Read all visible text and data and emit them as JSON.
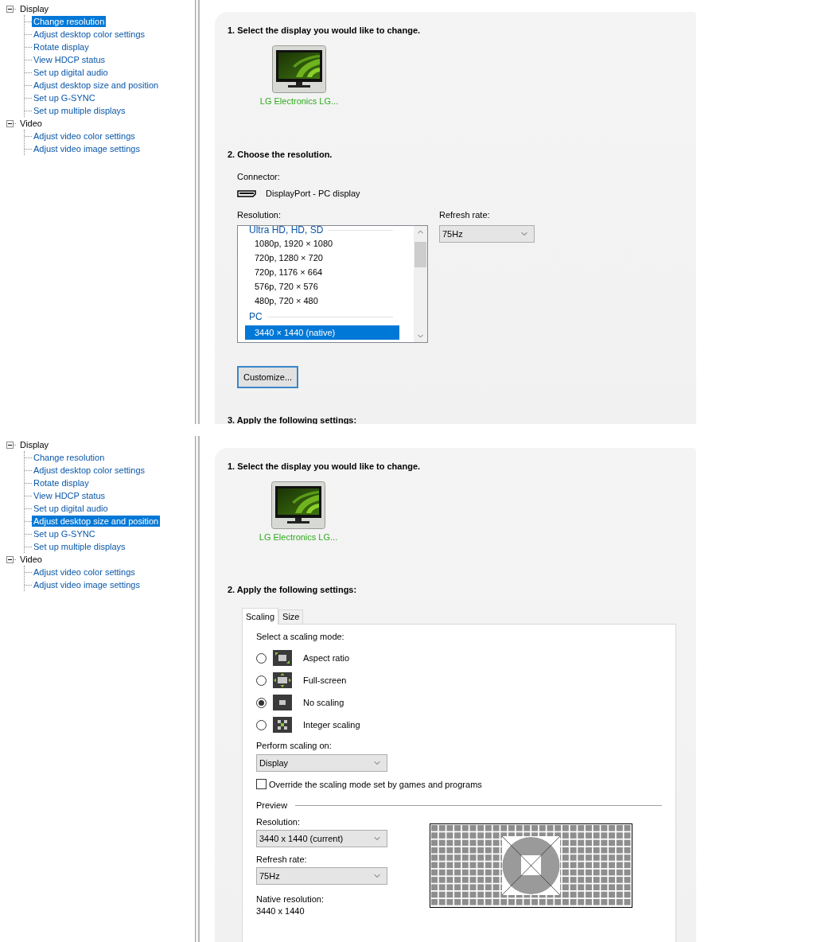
{
  "panels": [
    {
      "kind": "resolution",
      "tree": [
        {
          "label": "Display",
          "expanded": true,
          "selected": false,
          "children": [
            {
              "label": "Change resolution",
              "selected": true
            },
            {
              "label": "Adjust desktop color settings",
              "selected": false
            },
            {
              "label": "Rotate display",
              "selected": false
            },
            {
              "label": "View HDCP status",
              "selected": false
            },
            {
              "label": "Set up digital audio",
              "selected": false
            },
            {
              "label": "Adjust desktop size and position",
              "selected": false
            },
            {
              "label": "Set up G-SYNC",
              "selected": false
            },
            {
              "label": "Set up multiple displays",
              "selected": false
            }
          ]
        },
        {
          "label": "Video",
          "expanded": true,
          "selected": false,
          "children": [
            {
              "label": "Adjust video color settings",
              "selected": false
            },
            {
              "label": "Adjust video image settings",
              "selected": false
            }
          ]
        }
      ],
      "page": {
        "display_heading": "1. Select the display you would like to change.",
        "display": "LG Electronics LG...",
        "resolution_heading": "2. Choose the resolution.",
        "connector_label": "Connector:",
        "connector": "DisplayPort - PC display",
        "resolution_label": "Resolution:",
        "resolutions": [
          {
            "kind": "group",
            "label": "Ultra HD, HD, SD"
          },
          {
            "kind": "option",
            "label": "1080p, 1920 × 1080",
            "selected": false
          },
          {
            "kind": "option",
            "label": "720p, 1280 × 720",
            "selected": false
          },
          {
            "kind": "option",
            "label": "720p, 1176 × 664",
            "selected": false
          },
          {
            "kind": "option",
            "label": "576p, 720 × 576",
            "selected": false
          },
          {
            "kind": "option",
            "label": "480p, 720 × 480",
            "selected": false
          },
          {
            "kind": "group",
            "label": "PC"
          },
          {
            "kind": "option",
            "label": "3440 × 1440 (native)",
            "selected": true
          }
        ],
        "refresh_label": "Refresh rate:",
        "refresh": "75Hz",
        "customize": "Customize...",
        "next_heading": "3. Apply the following settings:"
      }
    },
    {
      "kind": "scaling",
      "tree": [
        {
          "label": "Display",
          "expanded": true,
          "selected": false,
          "children": [
            {
              "label": "Change resolution",
              "selected": false
            },
            {
              "label": "Adjust desktop color settings",
              "selected": false
            },
            {
              "label": "Rotate display",
              "selected": false
            },
            {
              "label": "View HDCP status",
              "selected": false
            },
            {
              "label": "Set up digital audio",
              "selected": false
            },
            {
              "label": "Adjust desktop size and position",
              "selected": true
            },
            {
              "label": "Set up G-SYNC",
              "selected": false
            },
            {
              "label": "Set up multiple displays",
              "selected": false
            }
          ]
        },
        {
          "label": "Video",
          "expanded": true,
          "selected": false,
          "children": [
            {
              "label": "Adjust video color settings",
              "selected": false
            },
            {
              "label": "Adjust video image settings",
              "selected": false
            }
          ]
        }
      ],
      "page": {
        "display_heading": "1. Select the display you would like to change.",
        "display": "LG Electronics LG...",
        "settings_heading": "2. Apply the following settings:",
        "tabs": [
          {
            "label": "Scaling",
            "selected": true
          },
          {
            "label": "Size",
            "selected": false
          }
        ],
        "mode_label": "Select a scaling mode:",
        "modes": [
          {
            "label": "Aspect ratio",
            "selected": false
          },
          {
            "label": "Full-screen",
            "selected": false
          },
          {
            "label": "No scaling",
            "selected": true
          },
          {
            "label": "Integer scaling",
            "selected": false
          }
        ],
        "perform_label": "Perform scaling on:",
        "perform": "Display",
        "override": {
          "label": "Override the scaling mode set by games and programs",
          "checked": false
        },
        "preview_label": "Preview",
        "preview_resolution_label": "Resolution:",
        "preview_resolution": "3440 x 1440 (current)",
        "preview_refresh_label": "Refresh rate:",
        "preview_refresh": "75Hz",
        "native_label": "Native resolution:",
        "native": "3440 x 1440"
      }
    }
  ]
}
